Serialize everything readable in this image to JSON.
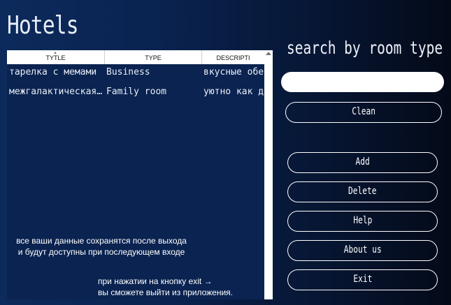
{
  "app": {
    "title": "Hotels"
  },
  "table": {
    "columns": [
      "TYTLE",
      "TYPE",
      "DESCRIPTI"
    ],
    "rows": [
      [
        "тарелка с мемами",
        "Business",
        "вкусные обеды"
      ],
      [
        "межгалактическая…",
        "Family room",
        "уютно как дома"
      ]
    ]
  },
  "hints": {
    "save_info": "все ваши данные сохранятся после выхода и будут доступны при последующем входе",
    "exit_info_line1": "при нажатии на кнопку exit →",
    "exit_info_line2": "вы сможете выйти из приложения."
  },
  "search": {
    "label": "search by room type",
    "value": "",
    "placeholder": ""
  },
  "buttons": {
    "clean": "Clean",
    "add": "Add",
    "delete": "Delete",
    "help": "Help",
    "about": "About us",
    "exit": "Exit"
  }
}
